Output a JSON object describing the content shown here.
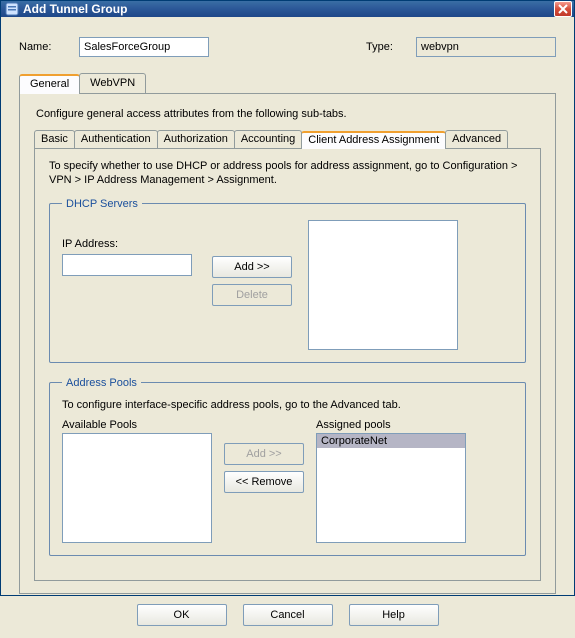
{
  "window": {
    "title": "Add Tunnel Group"
  },
  "form": {
    "name_label": "Name:",
    "name_value": "SalesForceGroup",
    "type_label": "Type:",
    "type_value": "webvpn"
  },
  "outer_tabs": {
    "items": [
      {
        "label": "General"
      },
      {
        "label": "WebVPN"
      }
    ],
    "active_index": 0
  },
  "general": {
    "description": "Configure general access attributes from the following sub-tabs.",
    "inner_tabs": {
      "items": [
        {
          "label": "Basic"
        },
        {
          "label": "Authentication"
        },
        {
          "label": "Authorization"
        },
        {
          "label": "Accounting"
        },
        {
          "label": "Client Address Assignment"
        },
        {
          "label": "Advanced"
        }
      ],
      "active_index": 4
    }
  },
  "caa": {
    "instructions": "To specify whether to use DHCP or address pools for address assignment, go to Configuration > VPN > IP Address Management > Assignment.",
    "dhcp": {
      "legend": "DHCP Servers",
      "ip_label": "IP Address:",
      "ip_value": "",
      "add_label": "Add >>",
      "delete_label": "Delete",
      "servers": []
    },
    "pools": {
      "legend": "Address Pools",
      "note": "To configure interface-specific address pools, go to the Advanced tab.",
      "available_label": "Available Pools",
      "assigned_label": "Assigned pools",
      "add_label": "Add >>",
      "remove_label": "<< Remove",
      "available": [],
      "assigned": [
        "CorporateNet"
      ]
    }
  },
  "footer": {
    "ok": "OK",
    "cancel": "Cancel",
    "help": "Help"
  }
}
